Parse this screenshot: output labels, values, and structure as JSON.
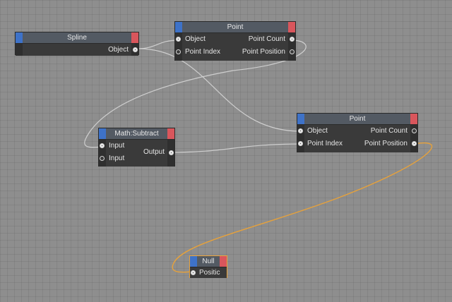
{
  "nodes": {
    "spline": {
      "title": "Spline",
      "ports_out": [
        "Object"
      ]
    },
    "point1": {
      "title": "Point",
      "ports_in": [
        "Object",
        "Point Index"
      ],
      "ports_out": [
        "Point Count",
        "Point Position"
      ]
    },
    "subtract": {
      "title": "Math:Subtract",
      "ports_in": [
        "Input",
        "Input"
      ],
      "ports_out": [
        "Output"
      ]
    },
    "point2": {
      "title": "Point",
      "ports_in": [
        "Object",
        "Point Index"
      ],
      "ports_out": [
        "Point Count",
        "Point Position"
      ]
    },
    "null": {
      "title": "Null",
      "ports_in": [
        "Positic"
      ]
    }
  },
  "colors": {
    "canvas": "#8e8e8e",
    "node_body": "#3a3a3a",
    "header_left": "#3e72c8",
    "header_right": "#d9565c",
    "wire": "#cfcfcf",
    "selected_wire": "#e8a23a"
  }
}
